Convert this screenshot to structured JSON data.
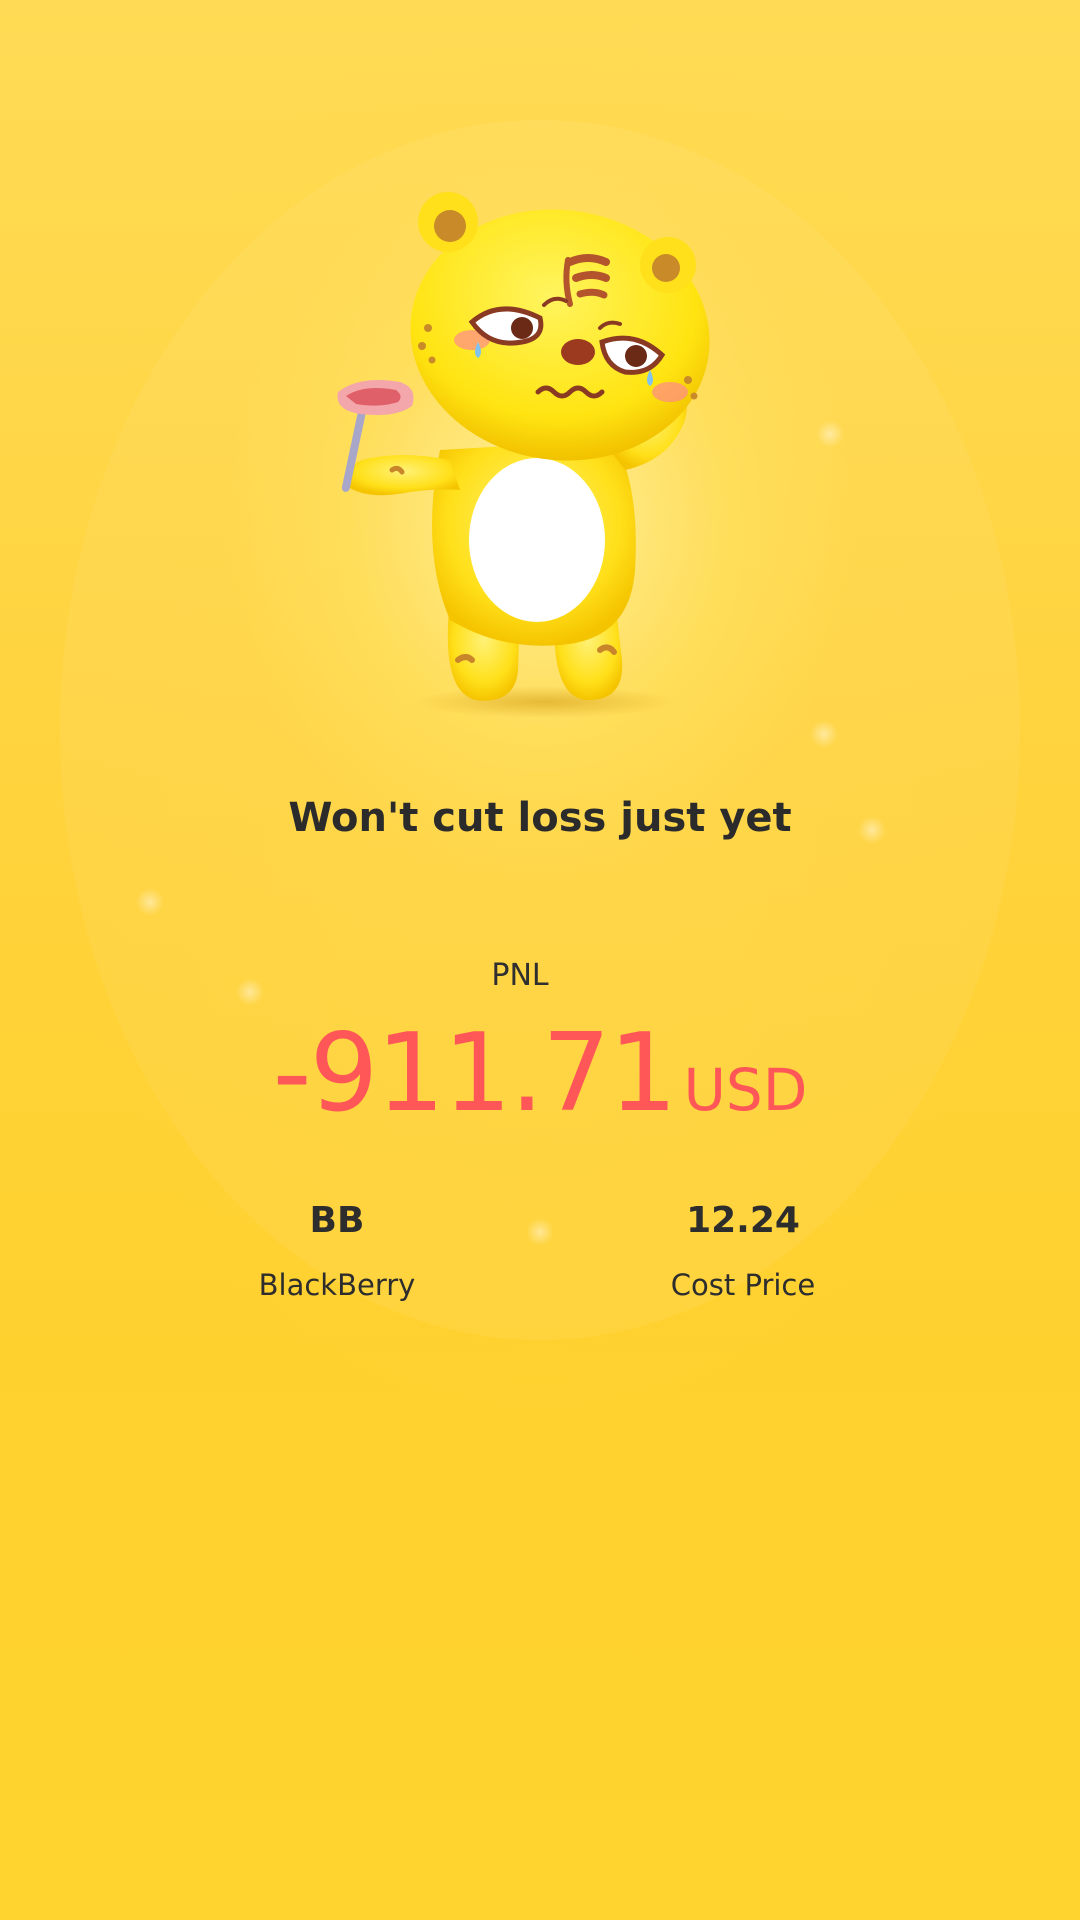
{
  "headline": "Won't cut loss just yet",
  "pnl": {
    "label": "PNL",
    "value": "-911.71",
    "unit": "USD",
    "color": "#ff5757"
  },
  "stock": {
    "symbol": "BB",
    "name": "BlackBerry"
  },
  "cost": {
    "value": "12.24",
    "label": "Cost Price"
  },
  "mascot": {
    "icon": "tiger-mascot-icon",
    "prop_icon": "meat-on-fork-icon"
  },
  "colors": {
    "background": "#ffd23a",
    "text": "#2b2b2b"
  }
}
